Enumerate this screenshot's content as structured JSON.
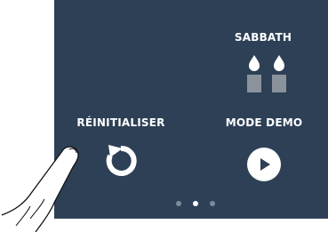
{
  "screen": {
    "bg_color": "#2d4056",
    "tiles": [
      {
        "id": "sabbath",
        "label": "SABBATH",
        "icon": "sabbath-candles-icon"
      },
      {
        "id": "reset",
        "label": "RÉINITIALISER",
        "icon": "reset-arrow-icon"
      },
      {
        "id": "demo",
        "label": "MODE DEMO",
        "icon": "play-icon"
      }
    ],
    "pager": {
      "count": 3,
      "active": 2
    }
  }
}
